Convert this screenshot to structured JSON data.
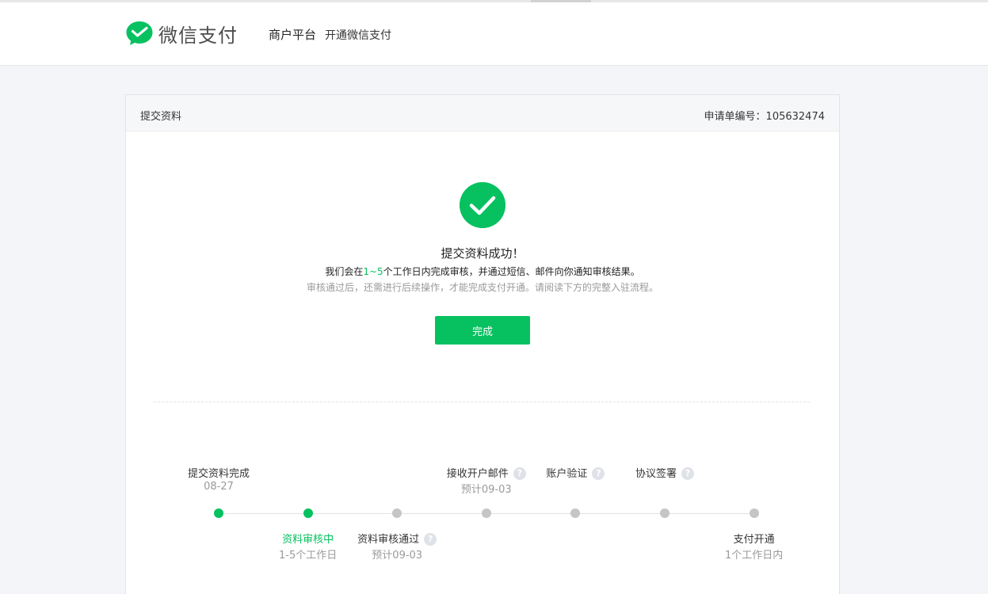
{
  "header": {
    "brand": "微信支付",
    "platform": "商户平台",
    "subtitle": "开通微信支付"
  },
  "card": {
    "title": "提交资料",
    "order_no": "申请单编号：105632474"
  },
  "result": {
    "title": "提交资料成功！",
    "line1_prefix": "我们会在",
    "line1_highlight": "1~5",
    "line1_suffix": "个工作日内完成审核，并通过短信、邮件向你通知审核结果。",
    "line2": "审核通过后，还需进行后续操作，才能完成支付开通。请阅读下方的完整入驻流程。",
    "done_button": "完成"
  },
  "steps": [
    {
      "label": "提交资料完成",
      "sub": "08-27",
      "status": "done",
      "position": "top",
      "help": false
    },
    {
      "label": "资料审核中",
      "sub": "1-5个工作日",
      "status": "active",
      "position": "bottom",
      "help": false
    },
    {
      "label": "资料审核通过",
      "sub": "预计09-03",
      "status": "pending",
      "position": "bottom",
      "help": true
    },
    {
      "label": "接收开户邮件",
      "sub": "预计09-03",
      "status": "pending",
      "position": "top",
      "help": true
    },
    {
      "label": "账户验证",
      "sub": "",
      "status": "pending",
      "position": "top",
      "help": true
    },
    {
      "label": "协议签署",
      "sub": "",
      "status": "pending",
      "position": "top",
      "help": true
    },
    {
      "label": "支付开通",
      "sub": "1个工作日内",
      "status": "pending",
      "position": "bottom",
      "help": false
    }
  ],
  "help_glyph": "?",
  "colors": {
    "accent": "#07c160",
    "pending_dot": "#c5c5c5",
    "muted_text": "#9a9a9a"
  },
  "icons": {
    "logo": "wechat-pay-logo-icon",
    "success": "check-circle-icon",
    "help": "question-circle-icon"
  }
}
